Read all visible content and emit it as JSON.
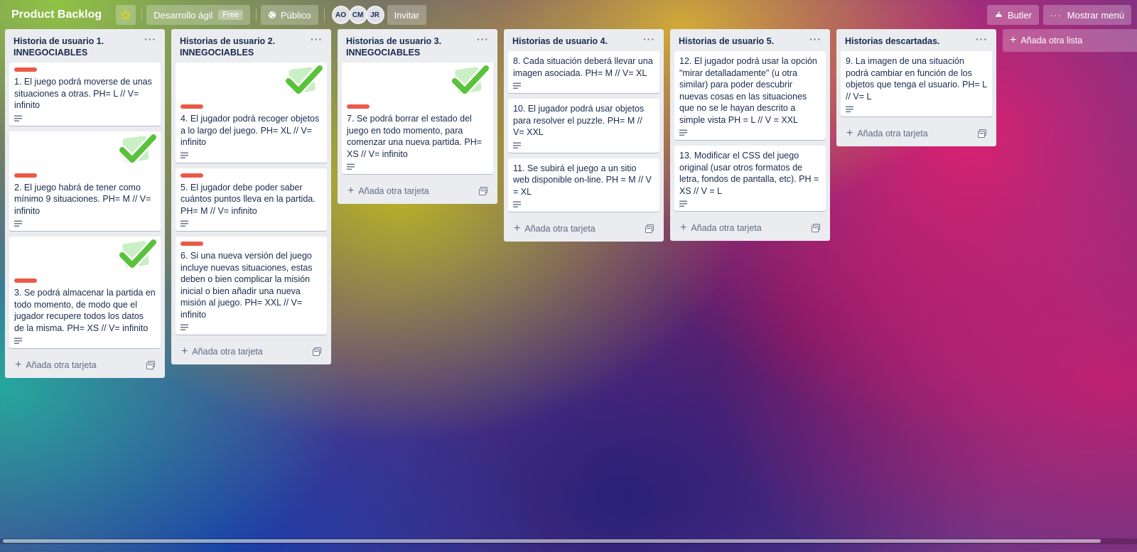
{
  "header": {
    "board_title": "Product Backlog",
    "star_icon": "star-icon",
    "team_label": "Desarrollo ágil",
    "free_badge": "Free",
    "visibility_label": "Público",
    "members": [
      "AO",
      "CM",
      "JR"
    ],
    "invite_label": "Invitar",
    "butler_label": "Butler",
    "menu_label": "Mostrar menú"
  },
  "colors": {
    "label_red": "#eb5a46",
    "check_green": "#5ac23a"
  },
  "add_card_label": "Añada otra tarjeta",
  "add_list_label": "Añada otra lista",
  "lists": [
    {
      "title": "Historia de usuario 1. INNEGOCIABLES",
      "cards": [
        {
          "text": "1. El juego podrá moverse de unas situaciones a otras. PH= L // V= infinito",
          "label": true,
          "cover": false
        },
        {
          "text": "2. El juego habrá de tener como mínimo 9 situaciones. PH= M // V= infinito",
          "label": true,
          "cover": true
        },
        {
          "text": "3. Se podrá almacenar la partida en todo momento, de modo que el jugador recupere todos los datos de la misma. PH= XS // V= infinito",
          "label": true,
          "cover": true
        }
      ]
    },
    {
      "title": "Historias de usuario 2. INNEGOCIABLES",
      "cards": [
        {
          "text": "4. El jugador podrá recoger objetos a lo largo del juego. PH= XL // V= infinito",
          "label": true,
          "cover": true
        },
        {
          "text": "5. El jugador debe poder saber cuántos puntos lleva en la partida. PH= M // V= infinito",
          "label": true,
          "cover": false
        },
        {
          "text": "6. Si una nueva versión del juego incluye nuevas situaciones, estas deben o bien complicar la misión inicial o bien añadir una nueva misión al juego. PH= XXL // V= infinito",
          "label": true,
          "cover": false
        }
      ]
    },
    {
      "title": "Historias de usuario 3. INNEGOCIABLES",
      "cards": [
        {
          "text": "7. Se podrá borrar el estado del juego en todo momento, para comenzar una nueva partida. PH= XS // V= infinito",
          "label": true,
          "cover": true
        }
      ]
    },
    {
      "title": "Historias de usuario 4.",
      "cards": [
        {
          "text": "8. Cada situación deberá llevar una imagen asociada. PH= M // V= XL",
          "label": false,
          "cover": false
        },
        {
          "text": "10. El jugador podrá usar objetos para resolver el puzzle. PH= M // V= XXL",
          "label": false,
          "cover": false
        },
        {
          "text": "11. Se subirá el juego a un sitio web disponible on-line. PH = M // V = XL",
          "label": false,
          "cover": false
        }
      ]
    },
    {
      "title": "Historias de usuario 5.",
      "cards": [
        {
          "text": "12. El jugador podrá usar la opción \"mirar detalladamente\" (u otra similar) para poder descubrir nuevas cosas en las situaciones que no se le hayan descrito a simple vista PH = L // V = XXL",
          "label": false,
          "cover": false
        },
        {
          "text": "13. Modificar el CSS del juego original (usar otros formatos de letra, fondos de pantalla, etc). PH = XS // V = L",
          "label": false,
          "cover": false
        }
      ]
    },
    {
      "title": "Historias descartadas.",
      "cards": [
        {
          "text": "9. La imagen de una situación podrá cambiar en función de los objetos que tenga el usuario. PH= L // V= L",
          "label": false,
          "cover": false
        }
      ]
    }
  ]
}
